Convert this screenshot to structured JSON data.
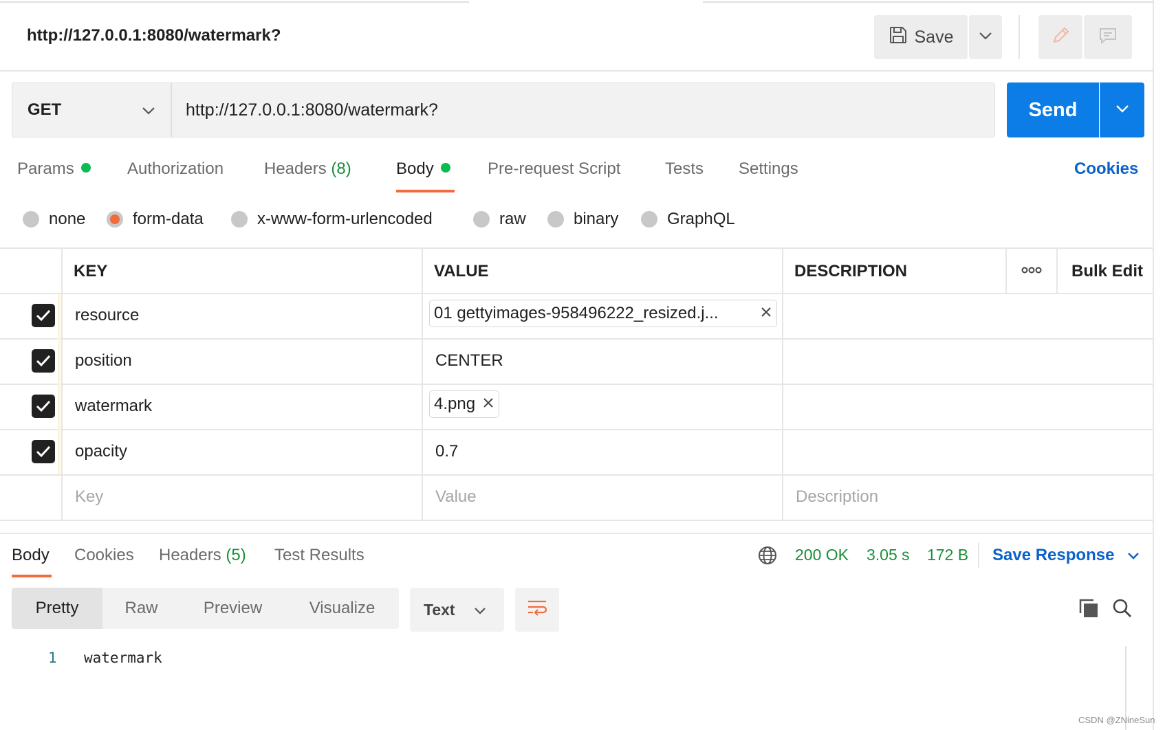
{
  "request": {
    "title": "http://127.0.0.1:8080/watermark?",
    "save_label": "Save",
    "method": "GET",
    "url": "http://127.0.0.1:8080/watermark?",
    "send_label": "Send"
  },
  "request_tabs": {
    "params": "Params",
    "authorization": "Authorization",
    "headers": "Headers",
    "headers_count": "(8)",
    "body": "Body",
    "pre_request": "Pre-request Script",
    "tests": "Tests",
    "settings": "Settings",
    "cookies": "Cookies"
  },
  "body_types": [
    "none",
    "form-data",
    "x-www-form-urlencoded",
    "raw",
    "binary",
    "GraphQL"
  ],
  "body_type_selected": "form-data",
  "table": {
    "headers": {
      "key": "KEY",
      "value": "VALUE",
      "description": "DESCRIPTION",
      "bulk_edit": "Bulk Edit"
    },
    "rows": [
      {
        "key": "resource",
        "value": "01 gettyimages-958496222_resized.j...",
        "is_file": true,
        "checked": true
      },
      {
        "key": "position",
        "value": "CENTER",
        "is_file": false,
        "checked": true
      },
      {
        "key": "watermark",
        "value": "4.png",
        "is_file": true,
        "checked": true
      },
      {
        "key": "opacity",
        "value": "0.7",
        "is_file": false,
        "checked": true
      }
    ],
    "placeholders": {
      "key": "Key",
      "value": "Value",
      "description": "Description"
    }
  },
  "response": {
    "tabs": {
      "body": "Body",
      "cookies": "Cookies",
      "headers": "Headers",
      "headers_count": "(5)",
      "test_results": "Test Results"
    },
    "status": "200 OK",
    "time": "3.05 s",
    "size": "172 B",
    "save_response": "Save Response",
    "views": [
      "Pretty",
      "Raw",
      "Preview",
      "Visualize"
    ],
    "active_view": "Pretty",
    "format": "Text",
    "lines": [
      {
        "no": "1",
        "text": "watermark"
      }
    ]
  },
  "footer": {
    "watermark": "CSDN @ZNineSun"
  },
  "colors": {
    "accent_orange": "#f26b3a",
    "send_blue": "#0c7ce6",
    "status_green": "#1a8f3a",
    "link_blue": "#0b63c9"
  }
}
